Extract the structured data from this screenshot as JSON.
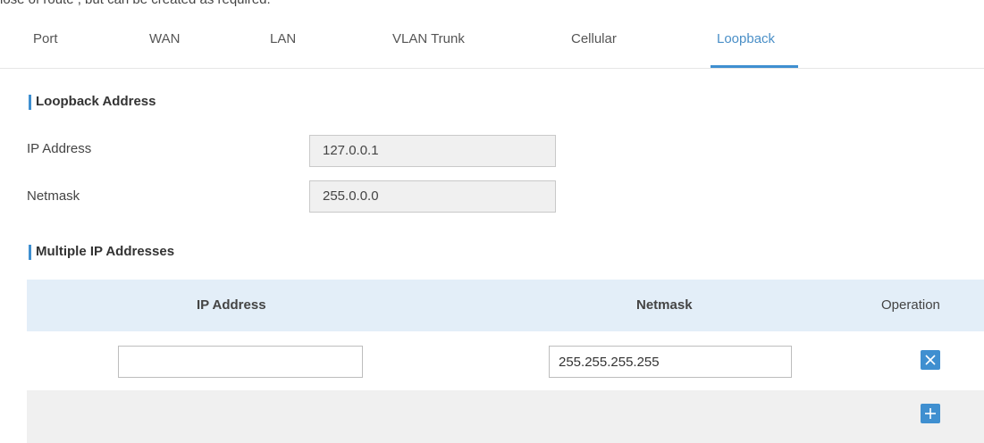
{
  "top_strip_text": "lose of route , but can be created as required.",
  "tabs": [
    {
      "label": "Port"
    },
    {
      "label": "WAN"
    },
    {
      "label": "LAN"
    },
    {
      "label": "VLAN Trunk"
    },
    {
      "label": "Cellular"
    },
    {
      "label": "Loopback",
      "active": true
    }
  ],
  "loopback": {
    "title": "Loopback Address",
    "ip_label": "IP Address",
    "ip_value": "127.0.0.1",
    "netmask_label": "Netmask",
    "netmask_value": "255.0.0.0"
  },
  "multiple": {
    "title": "Multiple IP Addresses",
    "columns": [
      "IP Address",
      "Netmask",
      "Operation"
    ],
    "rows": [
      {
        "ip": "",
        "netmask": "255.255.255.255"
      }
    ]
  },
  "colors": {
    "accent": "#3f8fd0",
    "header_bg": "#e3eef8",
    "readonly_bg": "#f0f0f0"
  },
  "icons": {
    "delete": "close-icon",
    "add": "plus-icon"
  }
}
